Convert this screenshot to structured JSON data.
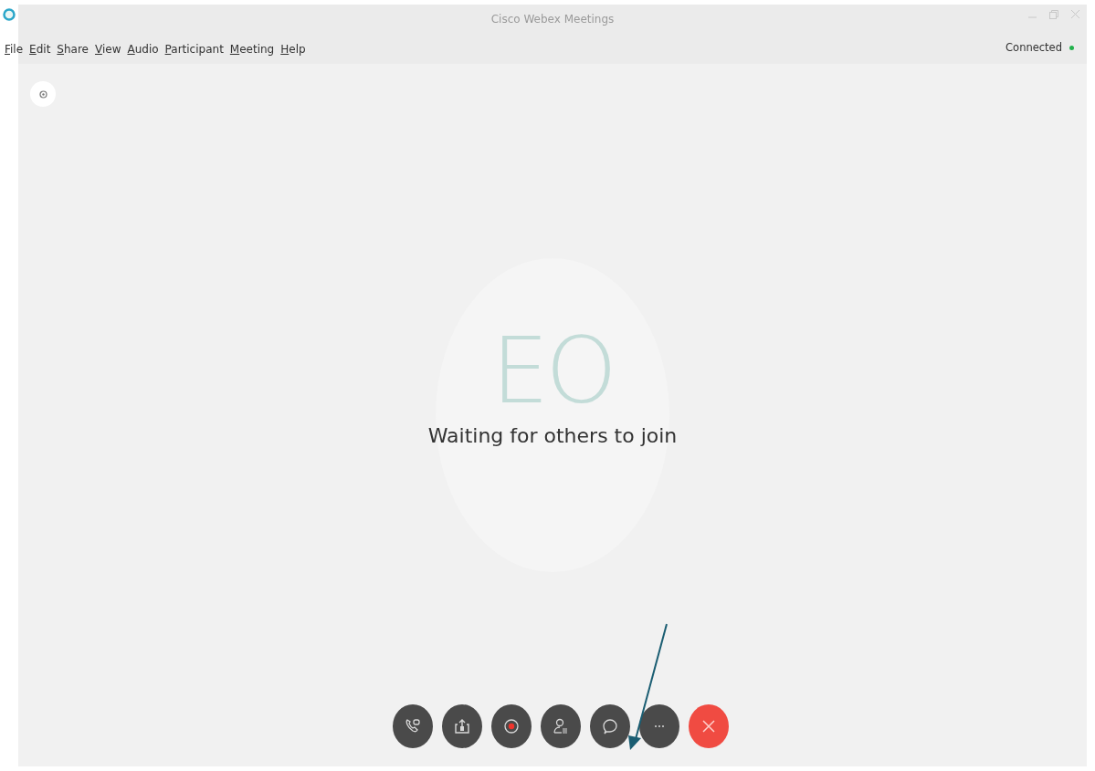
{
  "window": {
    "title": "Cisco Webex Meetings"
  },
  "menu": [
    "File",
    "Edit",
    "Share",
    "View",
    "Audio",
    "Participant",
    "Meeting",
    "Help"
  ],
  "status": {
    "text": "Connected",
    "color": "#22b14c"
  },
  "stage": {
    "initials": "EO",
    "message": "Waiting for others to join"
  },
  "controls": [
    {
      "kind": "call"
    },
    {
      "kind": "share"
    },
    {
      "kind": "record"
    },
    {
      "kind": "participants"
    },
    {
      "kind": "chat"
    },
    {
      "kind": "more"
    },
    {
      "kind": "leave"
    }
  ]
}
